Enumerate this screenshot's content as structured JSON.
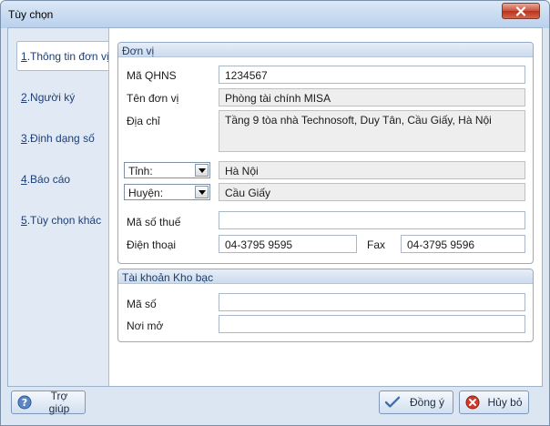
{
  "window": {
    "title": "Tùy chọn"
  },
  "sidebar": {
    "items": [
      {
        "num": "1",
        "label": ".Thông tin đơn vị"
      },
      {
        "num": "2",
        "label": ".Người ký"
      },
      {
        "num": "3",
        "label": ".Định dạng số"
      },
      {
        "num": "4",
        "label": ".Báo cáo"
      },
      {
        "num": "5",
        "label": ".Tùy chọn khác"
      }
    ]
  },
  "unit": {
    "group_title": "Đơn vị",
    "ma_qhns_label": "Mã QHNS",
    "ma_qhns_value": "1234567",
    "ten_don_vi_label": "Tên đơn vị",
    "ten_don_vi_value": "Phòng tài chính MISA",
    "dia_chi_label": "Địa chỉ",
    "dia_chi_value": "Tầng 9 tòa nhà Technosoft, Duy Tân, Cầu Giấy, Hà Nội",
    "tinh_label": "Tỉnh:",
    "tinh_value": "Hà Nội",
    "huyen_label": "Huyện:",
    "huyen_value": "Cầu Giấy",
    "ma_so_thue_label": "Mã số thuế",
    "ma_so_thue_value": "",
    "dien_thoai_label": "Điện thoại",
    "dien_thoai_value": "04-3795 9595",
    "fax_label": "Fax",
    "fax_value": "04-3795 9596"
  },
  "treasury": {
    "group_title": "Tài khoản Kho bạc",
    "ma_so_label": "Mã số",
    "ma_so_value": "",
    "noi_mo_label": "Nơi mở",
    "noi_mo_value": ""
  },
  "buttons": {
    "help": "Trợ giúp",
    "ok": "Đồng ý",
    "cancel": "Hủy bỏ"
  }
}
